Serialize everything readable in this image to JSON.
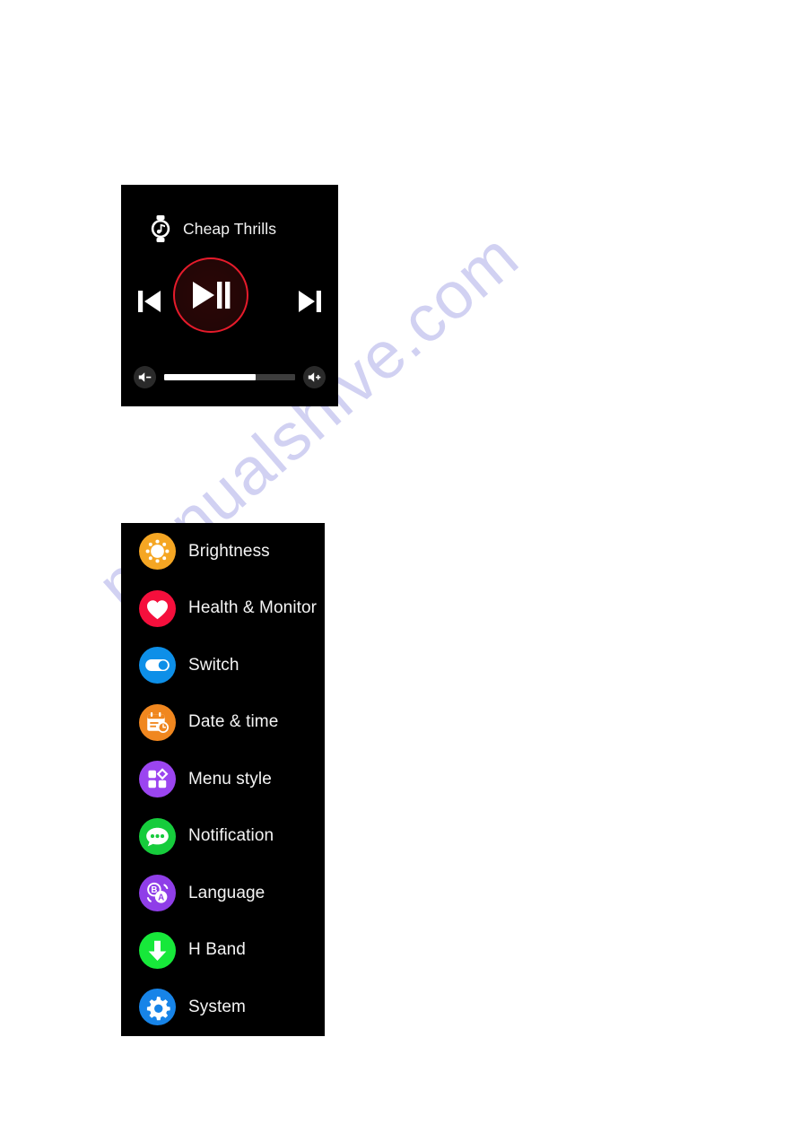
{
  "watermark": {
    "text": "manualshive.com",
    "color": "#c9c9f0"
  },
  "music_player": {
    "track_title": "Cheap Thrills",
    "app_icon": "watch-music-note-icon",
    "background": "#000000",
    "controls": {
      "previous_label": "Previous track",
      "play_pause_label": "Play / Pause",
      "next_label": "Next track",
      "play_button_ring_color": "#e51b2b"
    },
    "volume": {
      "level_percent": 70,
      "decrease_label": "Volume down",
      "increase_label": "Volume up",
      "fill_color": "#ffffff",
      "track_color": "#3d3d3d"
    }
  },
  "settings_menu": {
    "background": "#000000",
    "items": [
      {
        "label": "Brightness",
        "icon": "sun-icon",
        "color": "#f5a623"
      },
      {
        "label": "Health & Monitor",
        "icon": "heart-icon",
        "color": "#f50f3c"
      },
      {
        "label": "Switch",
        "icon": "toggle-switch-icon",
        "color": "#0d8fe8"
      },
      {
        "label": "Date & time",
        "icon": "calendar-clock-icon",
        "color": "#f0871f"
      },
      {
        "label": "Menu style",
        "icon": "grid-layout-icon",
        "color": "#9b45f0"
      },
      {
        "label": "Notification",
        "icon": "chat-bubble-icon",
        "color": "#16cc3c"
      },
      {
        "label": "Language",
        "icon": "letters-ba-icon",
        "color": "#8f3ee8"
      },
      {
        "label": "H Band",
        "icon": "download-arrow-icon",
        "color": "#17e83a"
      },
      {
        "label": "System",
        "icon": "gear-icon",
        "color": "#1784e8"
      }
    ]
  }
}
